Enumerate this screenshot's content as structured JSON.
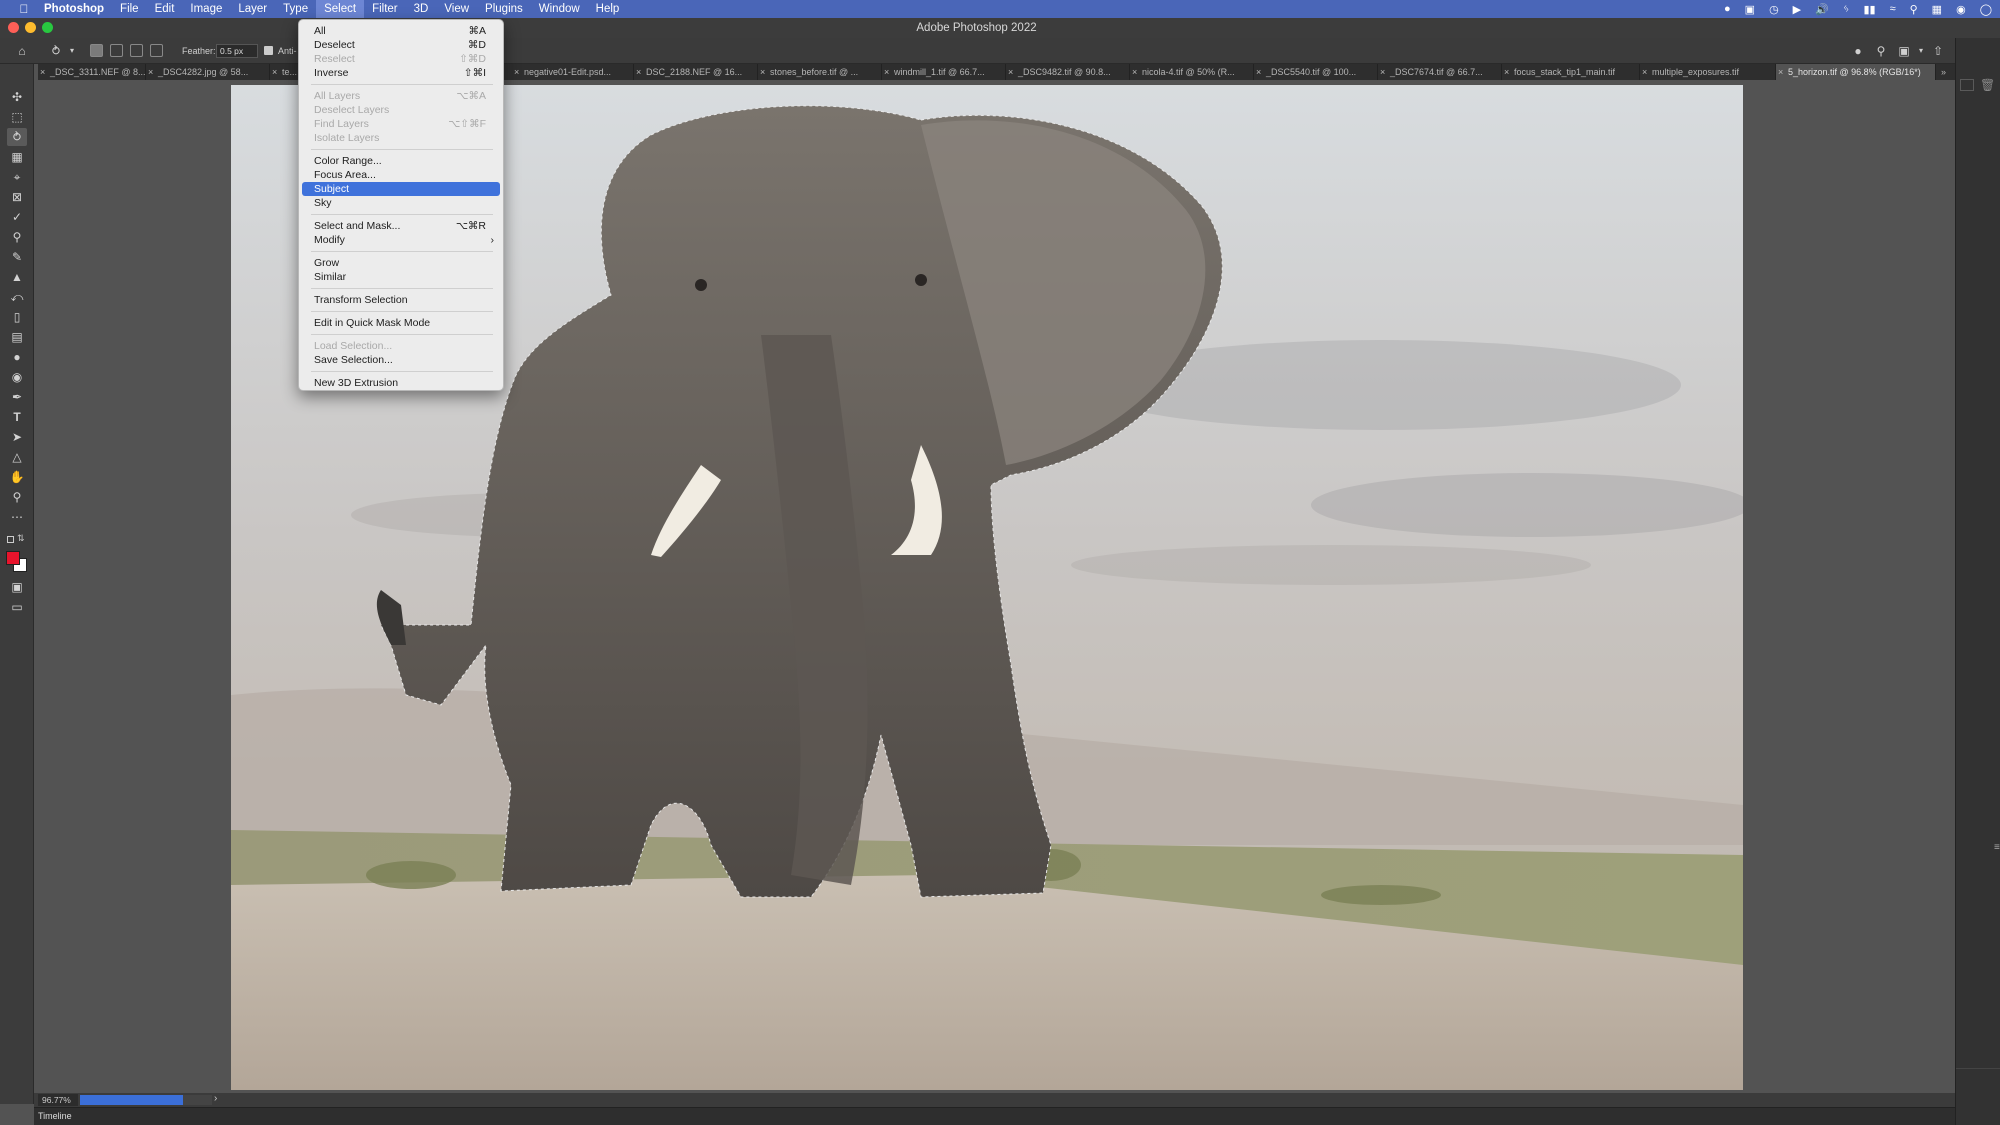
{
  "menubar": {
    "app": "Photoshop",
    "menus": [
      "File",
      "Edit",
      "Image",
      "Layer",
      "Type",
      "Select",
      "Filter",
      "3D",
      "View",
      "Plugins",
      "Window",
      "Help"
    ],
    "active_menu": "Select"
  },
  "window": {
    "title": "Adobe Photoshop 2022"
  },
  "options_bar": {
    "feather_label": "Feather:",
    "feather_value": "0.5 px",
    "anti_alias_label": "Anti-"
  },
  "tabs": [
    {
      "label": "_DSC_3311.NEF @ 8..."
    },
    {
      "label": "_DSC4282.jpg @ 58..."
    },
    {
      "label": "te..."
    },
    {
      "label": "negative01-Edit.psd..."
    },
    {
      "label": "DSC_2188.NEF @ 16..."
    },
    {
      "label": "stones_before.tif @ ..."
    },
    {
      "label": "windmill_1.tif @ 66.7..."
    },
    {
      "label": "_DSC9482.tif @ 90.8..."
    },
    {
      "label": "nicola-4.tif @ 50% (R..."
    },
    {
      "label": "_DSC5540.tif @ 100..."
    },
    {
      "label": "_DSC7674.tif @ 66.7..."
    },
    {
      "label": "focus_stack_tip1_main.tif"
    },
    {
      "label": "multiple_exposures.tif"
    },
    {
      "label": "5_horizon.tif @ 96.8% (RGB/16*)",
      "active": true
    }
  ],
  "select_menu": {
    "items": [
      {
        "label": "All",
        "shortcut": "⌘A"
      },
      {
        "label": "Deselect",
        "shortcut": "⌘D"
      },
      {
        "label": "Reselect",
        "shortcut": "⇧⌘D",
        "disabled": true
      },
      {
        "label": "Inverse",
        "shortcut": "⇧⌘I"
      },
      {
        "label": "All Layers",
        "shortcut": "⌥⌘A",
        "disabled": true
      },
      {
        "label": "Deselect Layers",
        "disabled": true
      },
      {
        "label": "Find Layers",
        "shortcut": "⌥⇧⌘F",
        "disabled": true
      },
      {
        "label": "Isolate Layers",
        "disabled": true
      },
      {
        "label": "Color Range..."
      },
      {
        "label": "Focus Area..."
      },
      {
        "label": "Subject",
        "highlighted": true
      },
      {
        "label": "Sky"
      },
      {
        "label": "Select and Mask...",
        "shortcut": "⌥⌘R"
      },
      {
        "label": "Modify",
        "submenu": true
      },
      {
        "label": "Grow"
      },
      {
        "label": "Similar"
      },
      {
        "label": "Transform Selection"
      },
      {
        "label": "Edit in Quick Mask Mode"
      },
      {
        "label": "Load Selection...",
        "disabled": true
      },
      {
        "label": "Save Selection..."
      },
      {
        "label": "New 3D Extrusion"
      }
    ],
    "submenu_glyph": "›"
  },
  "status_bar": {
    "zoom": "96.77%",
    "progress": 0.78,
    "arrow": "›"
  },
  "timeline": {
    "label": "Timeline"
  },
  "colors": {
    "menubar": "#4a66b8",
    "highlight": "#3f72db",
    "foreground_swatch": "#e8142c",
    "background_swatch": "#ffffff"
  },
  "icons": {
    "tools": [
      "move-icon",
      "marquee-icon",
      "lasso-icon",
      "object-select-icon",
      "crop-icon",
      "frame-icon",
      "eyedropper-icon",
      "healing-brush-icon",
      "brush-icon",
      "clone-stamp-icon",
      "history-brush-icon",
      "eraser-icon",
      "gradient-icon",
      "blur-icon",
      "dodge-icon",
      "pen-icon",
      "type-icon",
      "path-select-icon",
      "shape-icon",
      "hand-icon",
      "zoom-icon",
      "more-tools-icon"
    ]
  }
}
